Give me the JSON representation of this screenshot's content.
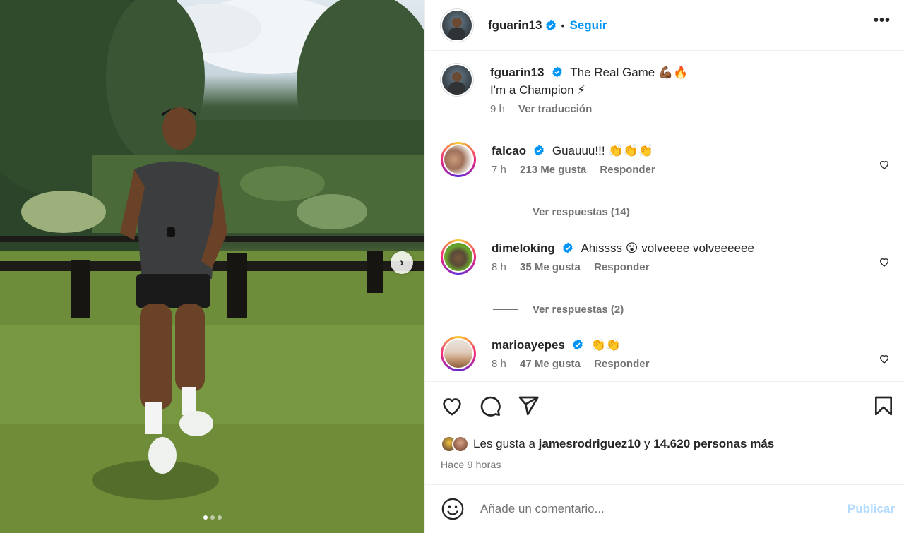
{
  "post": {
    "author": "fguarin13",
    "follow_label": "Seguir",
    "more_icon": "more-options-icon",
    "next_icon": "chevron-right-icon",
    "photo_dots": 3
  },
  "caption": {
    "user": "fguarin13",
    "line1": "The Real Game 💪🏾🔥",
    "line2": "I'm a Champion ⚡",
    "time": "9 h",
    "translate": "Ver traducción"
  },
  "comments": [
    {
      "user": "falcao",
      "text": "Guauuu!!! 👏👏👏",
      "time": "7 h",
      "likes": "213 Me gusta",
      "reply": "Responder",
      "replies": "Ver respuestas (14)"
    },
    {
      "user": "dimeloking",
      "text": "Ahissss 😮 volveeee volveeeeee",
      "time": "8 h",
      "likes": "35 Me gusta",
      "reply": "Responder",
      "replies": "Ver respuestas (2)"
    },
    {
      "user": "marioayepes",
      "text": "👏👏",
      "time": "8 h",
      "likes": "47 Me gusta",
      "reply": "Responder",
      "replies": ""
    }
  ],
  "likes": {
    "prefix": "Les gusta a",
    "user": "jamesrodriguez10",
    "connector": "y",
    "others": "14.620 personas más"
  },
  "time_ago": "Hace 9 horas",
  "comment_box": {
    "placeholder": "Añade un comentario...",
    "publish": "Publicar"
  },
  "colors": {
    "accent": "#0095f6",
    "verified": "#0095f6",
    "publish_disabled": "#b3dbff"
  }
}
